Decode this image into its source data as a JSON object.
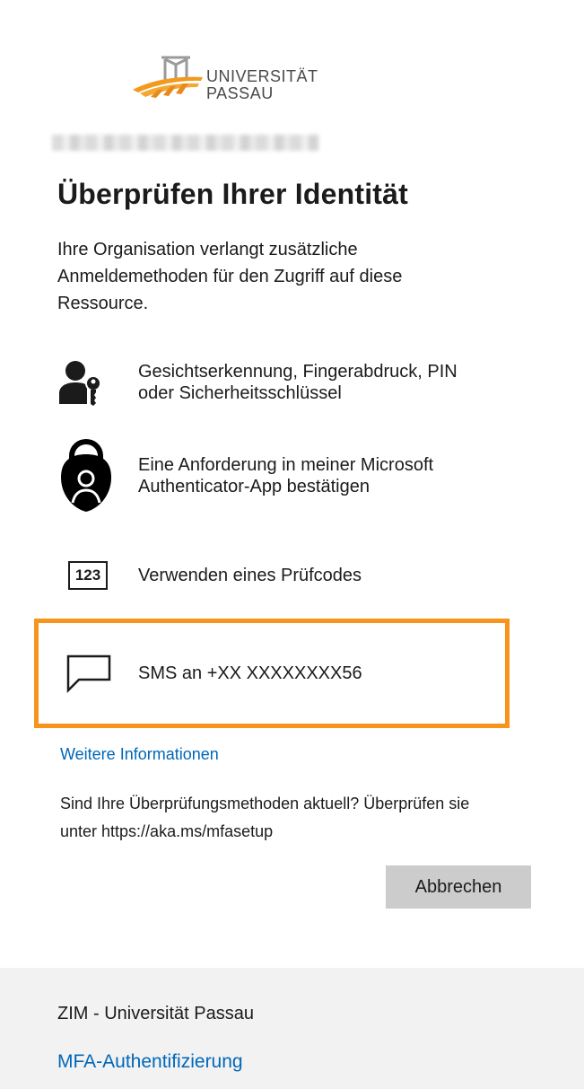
{
  "branding": {
    "logo_line1": "UNIVERSITÄT",
    "logo_line2": "PASSAU",
    "accent_color": "#f7941d",
    "link_color": "#0067b8"
  },
  "header": {
    "title": "Überprüfen Ihrer Identität",
    "description": "Ihre Organisation verlangt zusätzliche Anmeldemethoden für den Zugriff auf diese Ressource."
  },
  "methods": [
    {
      "icon": "person-key-icon",
      "label_line1": "Gesichtserkennung, Fingerabdruck, PIN",
      "label_line2": "oder Sicherheitsschlüssel"
    },
    {
      "icon": "authenticator-lock-icon",
      "label_line1": "Eine Anforderung in meiner Microsoft",
      "label_line2": "Authenticator-App bestätigen"
    },
    {
      "icon": "code-123-icon",
      "icon_text": "123",
      "label": "Verwenden eines Prüfcodes"
    },
    {
      "icon": "chat-bubble-icon",
      "label": "SMS an +XX XXXXXXXX56",
      "highlighted": true
    }
  ],
  "links": {
    "more_info": "Weitere Informationen"
  },
  "hint": {
    "line1": "Sind Ihre Überprüfungsmethoden aktuell? Überprüfen sie",
    "line2": "unter https://aka.ms/mfasetup"
  },
  "actions": {
    "cancel_label": "Abbrechen"
  },
  "footer": {
    "org": "ZIM - Universität Passau",
    "mfa_link": "MFA-Authentifizierung"
  }
}
